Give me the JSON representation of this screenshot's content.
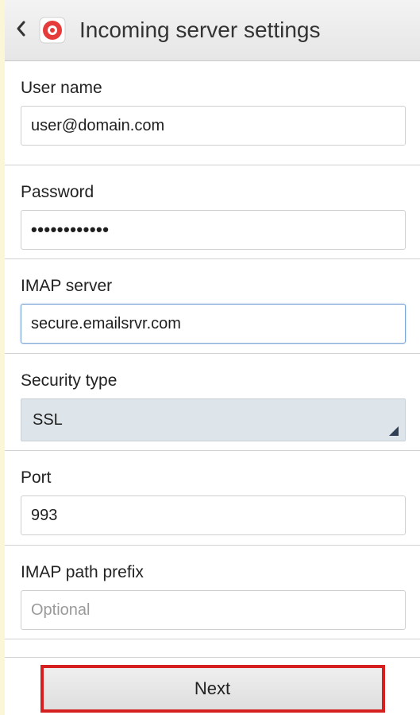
{
  "header": {
    "title": "Incoming server settings"
  },
  "fields": {
    "username": {
      "label": "User name",
      "value": "user@domain.com"
    },
    "password": {
      "label": "Password",
      "value": "••••••••••••"
    },
    "imap_server": {
      "label": "IMAP server",
      "value": "secure.emailsrvr.com"
    },
    "security_type": {
      "label": "Security type",
      "value": "SSL"
    },
    "port": {
      "label": "Port",
      "value": "993"
    },
    "imap_path_prefix": {
      "label": "IMAP path prefix",
      "placeholder": "Optional"
    }
  },
  "actions": {
    "next_label": "Next"
  },
  "colors": {
    "accent_red": "#d61f1f",
    "focus_blue": "#7aa3d6"
  }
}
